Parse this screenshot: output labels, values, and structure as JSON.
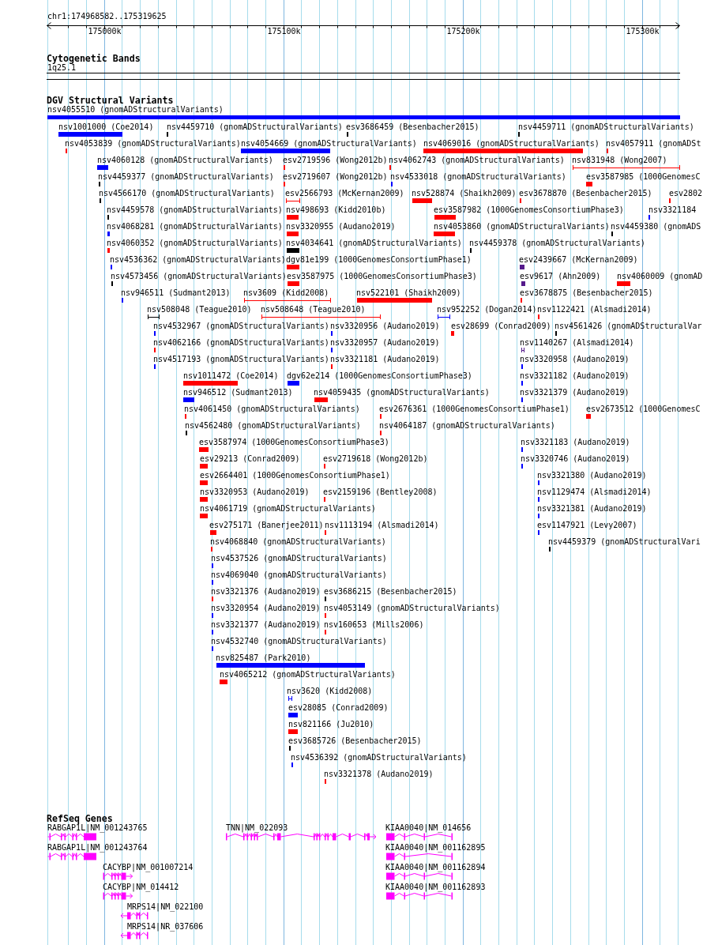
{
  "ruler": {
    "location": "chr1:174968582..175319625",
    "ticks": [
      "175000k",
      "175100k",
      "175200k",
      "175300k"
    ]
  },
  "cytogenetic_bands": {
    "title": "Cytogenetic Bands",
    "band": "1q25.1"
  },
  "dgv_structural_variants": {
    "title": "DGV Structural Variants",
    "rows": [
      [
        {
          "label": "nsv4055510 (gnomADStructuralVariants)",
          "color": "#0000ff",
          "kind": "bar"
        }
      ],
      [
        {
          "label": "nsv1001000 (Coe2014)",
          "color": "#0000ff",
          "kind": "bar"
        },
        {
          "label": "nsv4459710 (gnomADStructuralVariants)",
          "color": "#000000",
          "kind": "bar"
        },
        {
          "label": "esv3686459 (Besenbacher2015)",
          "color": "#000000",
          "kind": "bar"
        },
        {
          "label": "nsv4459711 (gnomADStructuralVariants)",
          "color": "#000000",
          "kind": "bar"
        }
      ],
      [
        {
          "label": "nsv4053839 (gnomADStructuralVariants)",
          "color": "#ff0000",
          "kind": "bar"
        },
        {
          "label": "nsv4054669 (gnomADStructuralVariants)",
          "color": "#0000ff",
          "kind": "bar"
        },
        {
          "label": "nsv4069016 (gnomADStructuralVariants)",
          "color": "#ff0000",
          "kind": "bar"
        },
        {
          "label": "nsv4057911 (gnomADSt",
          "color": "#ff0000",
          "kind": "bar"
        }
      ],
      [
        {
          "label": "nsv4060128 (gnomADStructuralVariants)",
          "color": "#0000ff",
          "kind": "bar"
        },
        {
          "label": "esv2719596 (Wong2012b)",
          "color": "#ff0000",
          "kind": "bar"
        },
        {
          "label": "nsv4062743 (gnomADStructuralVariants)",
          "color": "#ff0000",
          "kind": "bar"
        },
        {
          "label": "nsv831948 (Wong2007)",
          "color": "#ff0000",
          "kind": "interval"
        }
      ],
      [
        {
          "label": "nsv4459377 (gnomADStructuralVariants)",
          "color": "#000000",
          "kind": "bar"
        },
        {
          "label": "esv2719607 (Wong2012b)",
          "color": "#ff0000",
          "kind": "bar"
        },
        {
          "label": "nsv4533018 (gnomADStructuralVariants)",
          "color": "#0000ff",
          "kind": "bar"
        },
        {
          "label": "esv3587985 (1000GenomesC",
          "color": "#ff0000",
          "kind": "bar"
        }
      ],
      [
        {
          "label": "nsv4566170 (gnomADStructuralVariants)",
          "color": "#000000",
          "kind": "bar"
        },
        {
          "label": "esv2566793 (McKernan2009)",
          "color": "#ff0000",
          "kind": "interval"
        },
        {
          "label": "nsv528874 (Shaikh2009)",
          "color": "#ff0000",
          "kind": "bar"
        },
        {
          "label": "esv3678870 (Besenbacher2015)",
          "color": "#ff0000",
          "kind": "bar"
        },
        {
          "label": "esv2802",
          "color": "#ff0000",
          "kind": "bar"
        }
      ],
      [
        {
          "label": "nsv4459578 (gnomADStructuralVariants)",
          "color": "#000000",
          "kind": "bar"
        },
        {
          "label": "nsv498693 (Kidd2010b)",
          "color": "#ff0000",
          "kind": "bar"
        },
        {
          "label": "esv3587982 (1000GenomesConsortiumPhase3)",
          "color": "#ff0000",
          "kind": "bar"
        },
        {
          "label": "nsv3321184",
          "color": "#0000ff",
          "kind": "bar"
        }
      ],
      [
        {
          "label": "nsv4068281 (gnomADStructuralVariants)",
          "color": "#0000ff",
          "kind": "bar"
        },
        {
          "label": "nsv3320955 (Audano2019)",
          "color": "#ff0000",
          "kind": "bar"
        },
        {
          "label": "nsv4053860 (gnomADStructuralVariants)",
          "color": "#ff0000",
          "kind": "bar"
        },
        {
          "label": "nsv4459380 (gnomADS",
          "color": "#000000",
          "kind": "bar"
        }
      ],
      [
        {
          "label": "nsv4060352 (gnomADStructuralVariants)",
          "color": "#ff0000",
          "kind": "bar"
        },
        {
          "label": "nsv4034641 (gnomADStructuralVariants)",
          "color": "#000000",
          "kind": "bar"
        },
        {
          "label": "nsv4459378 (gnomADStructuralVariants)",
          "color": "#000000",
          "kind": "bar"
        }
      ],
      [
        {
          "label": "nsv4536362 (gnomADStructuralVariants)",
          "color": "#0000ff",
          "kind": "bar"
        },
        {
          "label": "dgv81e199 (1000GenomesConsortiumPhase1)",
          "color": "#ff0000",
          "kind": "bar"
        },
        {
          "label": "esv2439667 (McKernan2009)",
          "color": "#551a8b",
          "kind": "bar"
        }
      ],
      [
        {
          "label": "nsv4573456 (gnomADStructuralVariants)",
          "color": "#000000",
          "kind": "bar"
        },
        {
          "label": "esv3587975 (1000GenomesConsortiumPhase3)",
          "color": "#ff0000",
          "kind": "bar"
        },
        {
          "label": "esv9617 (Ahn2009)",
          "color": "#551a8b",
          "kind": "bar"
        },
        {
          "label": "nsv4060009 (gnomAD",
          "color": "#ff0000",
          "kind": "bar"
        }
      ],
      [
        {
          "label": "nsv946511 (Sudmant2013)",
          "color": "#0000ff",
          "kind": "bar"
        },
        {
          "label": "nsv3609 (Kidd2008)",
          "color": "#ff0000",
          "kind": "interval"
        },
        {
          "label": "nsv522101 (Shaikh2009)",
          "color": "#ff0000",
          "kind": "bar"
        },
        {
          "label": "esv3678875 (Besenbacher2015)",
          "color": "#ff0000",
          "kind": "bar"
        }
      ],
      [
        {
          "label": "nsv508048 (Teague2010)",
          "color": "#000000",
          "kind": "interval"
        },
        {
          "label": "nsv508648 (Teague2010)",
          "color": "#ff0000",
          "kind": "interval"
        },
        {
          "label": "nsv952252 (Dogan2014)",
          "color": "#0000ff",
          "kind": "interval"
        },
        {
          "label": "nsv1122421 (Alsmadi2014)",
          "color": "#ff0000",
          "kind": "bar"
        }
      ],
      [
        {
          "label": "nsv4532967 (gnomADStructuralVariants)",
          "color": "#0000ff",
          "kind": "bar"
        },
        {
          "label": "nsv3320956 (Audano2019)",
          "color": "#0000ff",
          "kind": "bar"
        },
        {
          "label": "esv28699 (Conrad2009)",
          "color": "#ff0000",
          "kind": "bar"
        },
        {
          "label": "nsv4561426 (gnomADStructuralVar",
          "color": "#000000",
          "kind": "bar"
        }
      ],
      [
        {
          "label": "nsv4062166 (gnomADStructuralVariants)",
          "color": "#ff0000",
          "kind": "bar"
        },
        {
          "label": "nsv3320957 (Audano2019)",
          "color": "#0000ff",
          "kind": "bar"
        },
        {
          "label": "nsv1140267 (Alsmadi2014)",
          "color": "#551a8b",
          "kind": "interval"
        }
      ],
      [
        {
          "label": "nsv4517193 (gnomADStructuralVariants)",
          "color": "#0000ff",
          "kind": "bar"
        },
        {
          "label": "nsv3321181 (Audano2019)",
          "color": "#ff0000",
          "kind": "bar"
        },
        {
          "label": "nsv3320958 (Audano2019)",
          "color": "#0000ff",
          "kind": "bar"
        }
      ],
      [
        {
          "label": "nsv1011472 (Coe2014)",
          "color": "#ff0000",
          "kind": "bar"
        },
        {
          "label": "dgv62e214 (1000GenomesConsortiumPhase3)",
          "color": "#0000ff",
          "kind": "bar"
        },
        {
          "label": "nsv3321182 (Audano2019)",
          "color": "#0000ff",
          "kind": "bar"
        }
      ],
      [
        {
          "label": "nsv946512 (Sudmant2013)",
          "color": "#0000ff",
          "kind": "bar"
        },
        {
          "label": "nsv4059435 (gnomADStructuralVariants)",
          "color": "#ff0000",
          "kind": "bar"
        },
        {
          "label": "nsv3321379 (Audano2019)",
          "color": "#0000ff",
          "kind": "bar"
        }
      ],
      [
        {
          "label": "nsv4061450 (gnomADStructuralVariants)",
          "color": "#ff0000",
          "kind": "bar"
        },
        {
          "label": "esv2676361 (1000GenomesConsortiumPhase1)",
          "color": "#ff0000",
          "kind": "bar"
        },
        {
          "label": "esv2673512 (1000GenomesC",
          "color": "#ff0000",
          "kind": "bar"
        }
      ],
      [
        {
          "label": "nsv4562480 (gnomADStructuralVariants)",
          "color": "#000000",
          "kind": "bar"
        },
        {
          "label": "nsv4064187 (gnomADStructuralVariants)",
          "color": "#ff0000",
          "kind": "bar"
        }
      ],
      [
        {
          "label": "esv3587974 (1000GenomesConsortiumPhase3)",
          "color": "#ff0000",
          "kind": "bar"
        },
        {
          "label": "nsv3321183 (Audano2019)",
          "color": "#0000ff",
          "kind": "bar"
        }
      ],
      [
        {
          "label": "esv29213 (Conrad2009)",
          "color": "#ff0000",
          "kind": "bar"
        },
        {
          "label": "esv2719618 (Wong2012b)",
          "color": "#ff0000",
          "kind": "bar"
        },
        {
          "label": "nsv3320746 (Audano2019)",
          "color": "#0000ff",
          "kind": "bar"
        }
      ],
      [
        {
          "label": "esv2664401 (1000GenomesConsortiumPhase1)",
          "color": "#ff0000",
          "kind": "bar"
        },
        {
          "label": "nsv3321380 (Audano2019)",
          "color": "#0000ff",
          "kind": "bar"
        }
      ],
      [
        {
          "label": "nsv3320953 (Audano2019)",
          "color": "#ff0000",
          "kind": "bar"
        },
        {
          "label": "esv2159196 (Bentley2008)",
          "color": "#ff0000",
          "kind": "bar"
        },
        {
          "label": "nsv1129474 (Alsmadi2014)",
          "color": "#0000ff",
          "kind": "bar"
        }
      ],
      [
        {
          "label": "nsv4061719 (gnomADStructuralVariants)",
          "color": "#ff0000",
          "kind": "bar"
        },
        {
          "label": "nsv3321381 (Audano2019)",
          "color": "#0000ff",
          "kind": "bar"
        }
      ],
      [
        {
          "label": "esv275171 (Banerjee2011)",
          "color": "#ff0000",
          "kind": "bar"
        },
        {
          "label": "nsv1113194 (Alsmadi2014)",
          "color": "#ff0000",
          "kind": "bar"
        },
        {
          "label": "esv1147921 (Levy2007)",
          "color": "#0000ff",
          "kind": "bar"
        }
      ],
      [
        {
          "label": "nsv4068840 (gnomADStructuralVariants)",
          "color": "#ff0000",
          "kind": "bar"
        },
        {
          "label": "nsv4459379 (gnomADStructuralVari",
          "color": "#000000",
          "kind": "bar"
        }
      ],
      [
        {
          "label": "nsv4537526 (gnomADStructuralVariants)",
          "color": "#0000ff",
          "kind": "bar"
        }
      ],
      [
        {
          "label": "nsv4069040 (gnomADStructuralVariants)",
          "color": "#0000ff",
          "kind": "bar"
        }
      ],
      [
        {
          "label": "nsv3321376 (Audano2019)",
          "color": "#ff0000",
          "kind": "bar"
        },
        {
          "label": "esv3686215 (Besenbacher2015)",
          "color": "#000000",
          "kind": "bar"
        }
      ],
      [
        {
          "label": "nsv3320954 (Audano2019)",
          "color": "#0000ff",
          "kind": "bar"
        },
        {
          "label": "nsv4053149 (gnomADStructuralVariants)",
          "color": "#ff0000",
          "kind": "bar"
        }
      ],
      [
        {
          "label": "nsv3321377 (Audano2019)",
          "color": "#0000ff",
          "kind": "bar"
        },
        {
          "label": "nsv160653 (Mills2006)",
          "color": "#ff0000",
          "kind": "bar"
        }
      ],
      [
        {
          "label": "nsv4532740 (gnomADStructuralVariants)",
          "color": "#0000ff",
          "kind": "bar"
        }
      ],
      [
        {
          "label": "nsv825487 (Park2010)",
          "color": "#0000ff",
          "kind": "bar"
        }
      ],
      [
        {
          "label": "nsv4065212 (gnomADStructuralVariants)",
          "color": "#ff0000",
          "kind": "bar"
        }
      ],
      [
        {
          "label": "nsv3620 (Kidd2008)",
          "color": "#0000ff",
          "kind": "interval"
        }
      ],
      [
        {
          "label": "esv28085 (Conrad2009)",
          "color": "#0000ff",
          "kind": "bar"
        }
      ],
      [
        {
          "label": "nsv821166 (Ju2010)",
          "color": "#ff0000",
          "kind": "bar"
        }
      ],
      [
        {
          "label": "esv3685726 (Besenbacher2015)",
          "color": "#000000",
          "kind": "bar"
        }
      ],
      [
        {
          "label": "nsv4536392 (gnomADStructuralVariants)",
          "color": "#0000ff",
          "kind": "bar"
        }
      ],
      [
        {
          "label": "nsv3321378 (Audano2019)",
          "color": "#ff0000",
          "kind": "bar"
        }
      ]
    ]
  },
  "refseq_genes": {
    "title": "RefSeq Genes",
    "rows": [
      [
        {
          "label": "RABGAP1L|NM_001243765",
          "arrow_forward": false,
          "arrow_reverse": false
        },
        {
          "label": "TNN|NM_022093",
          "arrow_forward": true,
          "arrow_reverse": false
        },
        {
          "label": "KIAA0040|NM_014656",
          "arrow_forward": false,
          "arrow_reverse": false
        }
      ],
      [
        {
          "label": "RABGAP1L|NM_001243764",
          "arrow_forward": false,
          "arrow_reverse": false
        },
        {
          "label": "KIAA0040|NM_001162895",
          "arrow_forward": false,
          "arrow_reverse": false
        }
      ],
      [
        {
          "label": "CACYBP|NM_001007214",
          "arrow_forward": true,
          "arrow_reverse": false
        },
        {
          "label": "KIAA0040|NM_001162894",
          "arrow_forward": false,
          "arrow_reverse": false
        }
      ],
      [
        {
          "label": "CACYBP|NM_014412",
          "arrow_forward": true,
          "arrow_reverse": false
        },
        {
          "label": "KIAA0040|NM_001162893",
          "arrow_forward": false,
          "arrow_reverse": false
        }
      ],
      [
        {
          "label": "MRPS14|NM_022100",
          "arrow_forward": false,
          "arrow_reverse": true
        }
      ],
      [
        {
          "label": "MRPS14|NR_037606",
          "arrow_forward": false,
          "arrow_reverse": true
        }
      ]
    ]
  }
}
